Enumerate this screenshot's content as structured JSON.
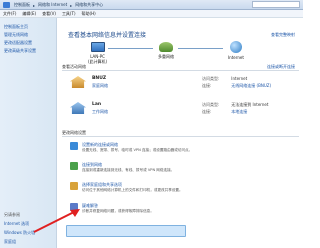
{
  "address_bar": {
    "crumbs": [
      "控制面板",
      "网络和 Internet",
      "网络和共享中心"
    ]
  },
  "menu": [
    "文件(F)",
    "编辑(E)",
    "查看(V)",
    "工具(T)",
    "帮助(H)"
  ],
  "sidebar": {
    "items": [
      "控制面板主页",
      "管理无线网络",
      "更改适配器设置",
      "更改高级共享设置"
    ],
    "see_also_label": "另请参阅",
    "see_also": [
      "Internet 选项",
      "Windows 防火墙",
      "家庭组"
    ]
  },
  "main": {
    "title": "查看基本网络信息并设置连接",
    "full_map_link": "查看完整映射",
    "map": {
      "nodes": [
        {
          "label": "LAN-PC",
          "sub": "(此计算机)"
        },
        {
          "label": "多重网络",
          "sub": ""
        },
        {
          "label": "Internet",
          "sub": ""
        }
      ]
    },
    "active_networks_label": "查看活动网络",
    "connect_disconnect_link": "连接或断开连接",
    "networks": [
      {
        "name": "BNUZ",
        "type": "家庭网络",
        "rows": [
          {
            "key": "访问类型:",
            "value": "Internet",
            "link": false
          },
          {
            "key": "连接:",
            "value": "无线网络连接 (BNUZ)",
            "link": true
          }
        ]
      },
      {
        "name": "Lan",
        "type": "工作网络",
        "rows": [
          {
            "key": "访问类型:",
            "value": "无法连接到 Internet",
            "link": false
          },
          {
            "key": "连接:",
            "value": "本地连接",
            "link": true
          }
        ]
      }
    ],
    "change_settings_label": "更改网络设置",
    "tasks": [
      {
        "title": "设置新的连接或网络",
        "desc": "设置无线、宽带、拨号、临时或 VPN 连接；或设置路由器或访问点。",
        "color": "#3a8ad8"
      },
      {
        "title": "连接到网络",
        "desc": "连接到或重新连接到无线、有线、拨号或 VPN 网络连接。",
        "color": "#4aa04a"
      },
      {
        "title": "选择家庭组和共享选项",
        "desc": "访问位于其他网络计算机上的文件和打印机，或更改共享设置。",
        "color": "#d8a23a"
      },
      {
        "title": "疑难解答",
        "desc": "诊断并修复网络问题，或获得故障排除信息。",
        "color": "#5a7ac8"
      }
    ]
  }
}
